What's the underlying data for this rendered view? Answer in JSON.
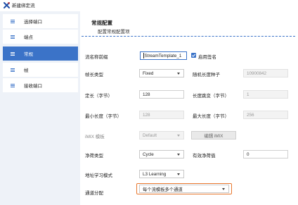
{
  "window": {
    "title": "新建绑定流"
  },
  "sidebar": {
    "items": [
      {
        "label": "选择端口",
        "active": false
      },
      {
        "label": "端点",
        "active": false
      },
      {
        "label": "常规",
        "active": true
      },
      {
        "label": "帧",
        "active": false
      },
      {
        "label": "接收端口",
        "active": false
      }
    ]
  },
  "section": {
    "title": "常规配置",
    "subtitle": "配置常规配置项"
  },
  "form": {
    "stream_name": {
      "label": "流名称前缀",
      "value": "StreamTemplate_1"
    },
    "signature": {
      "label": "启用签名",
      "checked": true
    },
    "frame_length_type": {
      "label": "帧长类型",
      "value": "Fixed"
    },
    "random_seed": {
      "label": "随机长度种子",
      "value": "10900842"
    },
    "fixed_length": {
      "label": "定长（字节）",
      "value": "128"
    },
    "length_step": {
      "label": "长度跳变（字节）",
      "value": "1"
    },
    "min_length": {
      "label": "最小长度（字节）",
      "value": "128"
    },
    "max_length": {
      "label": "最大长度（字节）",
      "value": "256"
    },
    "imix_template": {
      "label": "iMIX 模板",
      "value": "Default"
    },
    "edit_imix": {
      "label": "编辑 iMIX"
    },
    "payload_type": {
      "label": "净荷类型",
      "value": "Cycle"
    },
    "payload_value": {
      "label": "有效净荷值",
      "value": "0"
    },
    "address_learning": {
      "label": "地址学习模式",
      "value": "L3 Learning"
    },
    "channel_allocation": {
      "label": "通道分配",
      "value": "每个流模板多个通道"
    }
  },
  "colors": {
    "accent": "#3b73c8",
    "highlight": "#e8772e",
    "sidebar_bg": "#eef2f8"
  }
}
